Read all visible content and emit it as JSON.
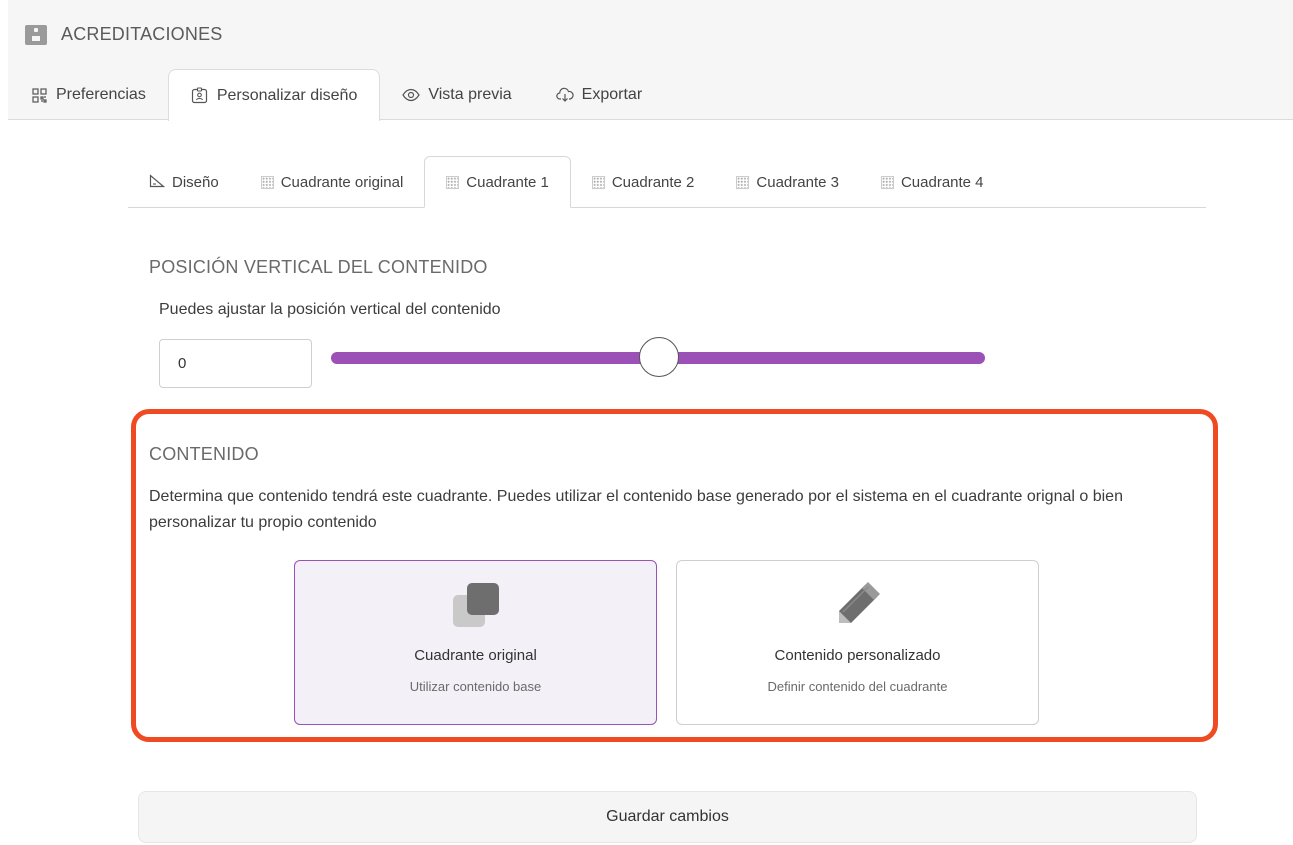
{
  "app": {
    "title": "ACREDITACIONES",
    "icon": "id-badge-icon"
  },
  "top_tabs": [
    {
      "label": "Preferencias",
      "icon": "qr-code-icon",
      "active": false
    },
    {
      "label": "Personalizar diseño",
      "icon": "badge-design-icon",
      "active": true
    },
    {
      "label": "Vista previa",
      "icon": "eye-icon",
      "active": false
    },
    {
      "label": "Exportar",
      "icon": "cloud-download-icon",
      "active": false
    }
  ],
  "sub_tabs": [
    {
      "label": "Diseño",
      "icon": "ruler-icon",
      "active": false
    },
    {
      "label": "Cuadrante original",
      "icon": "dot-grid-icon",
      "active": false
    },
    {
      "label": "Cuadrante 1",
      "icon": "dot-grid-icon",
      "active": true
    },
    {
      "label": "Cuadrante 2",
      "icon": "dot-grid-icon",
      "active": false
    },
    {
      "label": "Cuadrante 3",
      "icon": "dot-grid-icon",
      "active": false
    },
    {
      "label": "Cuadrante 4",
      "icon": "dot-grid-icon",
      "active": false
    }
  ],
  "vertical_position": {
    "title": "POSICIÓN VERTICAL DEL CONTENIDO",
    "description": "Puedes ajustar la posición vertical del contenido",
    "value": "0",
    "slider_level": 0.5,
    "slider_color": "#9b51b5"
  },
  "content": {
    "title": "CONTENIDO",
    "description": "Determina que contenido tendrá este cuadrante. Puedes utilizar el contenido base generado por el sistema en el cuadrante orignal o bien personalizar tu propio contenido",
    "highlight_color": "#f04a23",
    "options": [
      {
        "title": "Cuadrante original",
        "subtitle": "Utilizar contenido base",
        "icon": "copy-icon",
        "selected": true
      },
      {
        "title": "Contenido personalizado",
        "subtitle": "Definir contenido del cuadrante",
        "icon": "pencil-icon",
        "selected": false
      }
    ]
  },
  "save_label": "Guardar cambios"
}
